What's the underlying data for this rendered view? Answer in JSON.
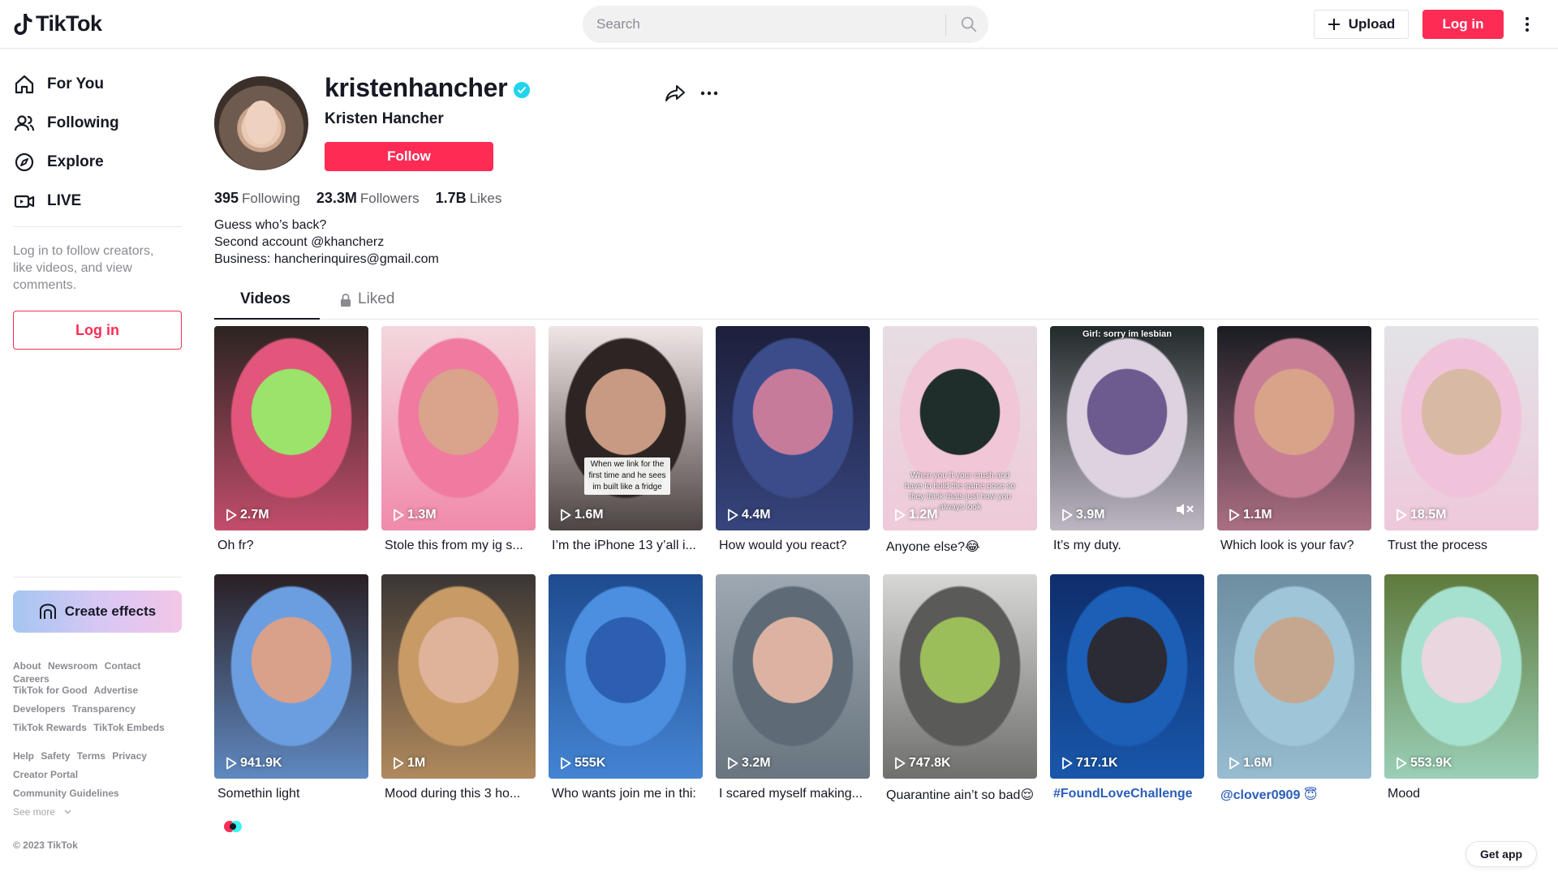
{
  "header": {
    "logo_text": "TikTok",
    "search_placeholder": "Search",
    "upload_label": "Upload",
    "login_label": "Log in"
  },
  "sidebar": {
    "items": [
      {
        "label": "For You",
        "icon": "home-icon"
      },
      {
        "label": "Following",
        "icon": "users-icon"
      },
      {
        "label": "Explore",
        "icon": "compass-icon"
      },
      {
        "label": "LIVE",
        "icon": "live-icon"
      }
    ],
    "login_prompt": "Log in to follow creators, like videos, and view comments.",
    "login_button": "Log in",
    "create_effects": "Create effects",
    "footer_rows": [
      [
        "About",
        "Newsroom",
        "Contact",
        "Careers"
      ],
      [
        "TikTok for Good",
        "Advertise"
      ],
      [
        "Developers",
        "Transparency"
      ],
      [
        "TikTok Rewards",
        "TikTok Embeds"
      ],
      [
        "Help",
        "Safety",
        "Terms",
        "Privacy"
      ],
      [
        "Creator Portal"
      ],
      [
        "Community Guidelines"
      ]
    ],
    "see_more": "See more",
    "copyright": "© 2023 TikTok"
  },
  "profile": {
    "username": "kristenhancher",
    "nickname": "Kristen Hancher",
    "follow_label": "Follow",
    "following_count": "395",
    "following_label": "Following",
    "followers_count": "23.3M",
    "followers_label": "Followers",
    "likes_count": "1.7B",
    "likes_label": "Likes",
    "bio": [
      "Guess who’s back?",
      "Second account @khancherz",
      "Business: hancherinquires@gmail.com"
    ]
  },
  "tabs": {
    "videos": "Videos",
    "liked": "Liked"
  },
  "videos": [
    {
      "views": "2.7M",
      "caption": "Oh fr?",
      "colors": [
        "#2b2420",
        "#e1567a",
        "#9be36b"
      ]
    },
    {
      "views": "1.3M",
      "caption": "Stole this from my ig s...",
      "colors": [
        "#f3d7dd",
        "#f07aa0",
        "#d9a48b"
      ]
    },
    {
      "views": "1.6M",
      "caption": "I’m the iPhone 13 y’all i...",
      "colors": [
        "#efe6e6",
        "#2c2523",
        "#c99a83"
      ],
      "overlay": "When we link for the first time and he sees im built like a fridge"
    },
    {
      "views": "4.4M",
      "caption": "How would you react?",
      "colors": [
        "#1d1f3a",
        "#3b4c8a",
        "#c67b9b"
      ]
    },
    {
      "views": "1.2M",
      "caption": "Anyone else?😂",
      "colors": [
        "#e6dde3",
        "#f1c6d6",
        "#1f2d2b"
      ],
      "overlay_plain": "When you ft your crush and have to hold the same pose so they think thats just how you always look"
    },
    {
      "views": "3.9M",
      "caption": "It’s my duty.",
      "colors": [
        "#222a2b",
        "#dcd2e0",
        "#6d5b8f"
      ],
      "top_text": "Girl: sorry im lesbian",
      "muted": true
    },
    {
      "views": "1.1M",
      "caption": "Which look is your fav?",
      "colors": [
        "#1a1c22",
        "#c87f96",
        "#d9a38a"
      ]
    },
    {
      "views": "18.5M",
      "caption": "Trust the process",
      "colors": [
        "#e2e3e7",
        "#f1c3da",
        "#d8b9a4"
      ]
    },
    {
      "views": "941.9K",
      "caption": "Somethin light",
      "colors": [
        "#2a1f24",
        "#6a9ee0",
        "#d9a08a"
      ]
    },
    {
      "views": "1M",
      "caption": "Mood during this 3 ho...",
      "colors": [
        "#3a3634",
        "#c89a66",
        "#dfb29a"
      ]
    },
    {
      "views": "555K",
      "caption": "Who wants join me in thi:",
      "colors": [
        "#1e4b8e",
        "#4c8fe0",
        "#2d5fb0"
      ]
    },
    {
      "views": "3.2M",
      "caption": "I scared myself making...",
      "colors": [
        "#9ea8b2",
        "#5e6a75",
        "#dcb3a2"
      ]
    },
    {
      "views": "747.8K",
      "caption": "Quarantine ain’t so bad😌",
      "colors": [
        "#d7d7d5",
        "#5a5a58",
        "#9bbd5a"
      ]
    },
    {
      "views": "717.1K",
      "caption": "#FoundLoveChallenge",
      "colors": [
        "#0f2d6b",
        "#1b5fb7",
        "#2b2b35"
      ],
      "link": true
    },
    {
      "views": "1.6M",
      "caption": "@clover0909 😇",
      "colors": [
        "#6e8fa2",
        "#9fc5d8",
        "#c5a68f"
      ],
      "link": true
    },
    {
      "views": "553.9K",
      "caption": "Mood",
      "colors": [
        "#5f7a3c",
        "#a6e0cf",
        "#e9d6df"
      ]
    }
  ],
  "get_app": "Get app",
  "accent_color": "#fe2c55"
}
